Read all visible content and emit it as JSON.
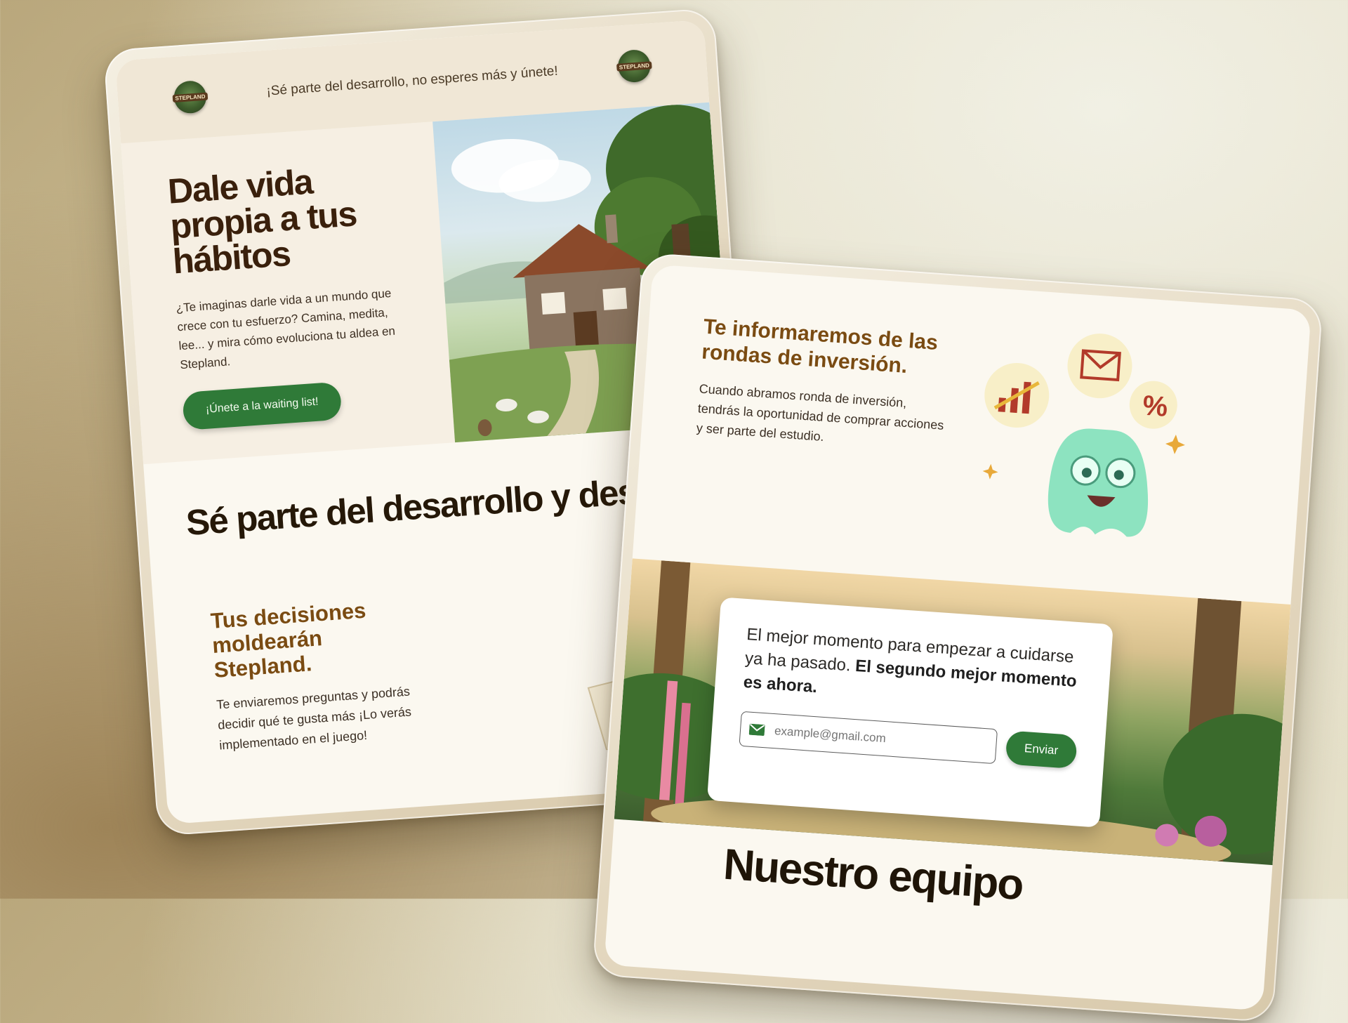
{
  "colors": {
    "accent_green": "#2f7a38",
    "heading_brown": "#7a4b12",
    "dark_title": "#251808",
    "paper": "#fbf8f0"
  },
  "tablet_a": {
    "topbar": {
      "logo_left": "STEPLAND",
      "logo_right": "STEPLAND",
      "message": "¡Sé parte del desarrollo, no esperes más y únete!"
    },
    "hero": {
      "title": "Dale vida propia a tus hábitos",
      "body": "¿Te imaginas darle vida a un mundo que crece con tu esfuerzo? Camina, medita, lee... y mira cómo evoluciona tu aldea en Stepland.",
      "cta_label": "¡Únete a la waiting list!",
      "image_icon": "cottage-illustration"
    },
    "section": {
      "title": "Sé parte del desarrollo y desbloquea contenido limita"
    },
    "feature": {
      "title": "Tus decisiones moldearán Stepland.",
      "body": "Te enviaremos preguntas y podrás decidir qué te gusta más ¡Lo verás implementado en el juego!",
      "art_icon": "mascot-notebook-illustration"
    }
  },
  "tablet_b": {
    "investment": {
      "title": "Te informaremos de las rondas de inversión.",
      "body": "Cuando abramos ronda de inversión, tendrás la oportunidad de comprar acciones y ser parte del estudio.",
      "art_icon": "ghost-mascot-illustration"
    },
    "cta": {
      "text_plain": "El mejor momento para empezar a cuidarse ya ha pasado.",
      "text_bold": "El segundo mejor momento es ahora.",
      "email_placeholder": "example@gmail.com",
      "email_icon": "mail-icon",
      "send_label": "Enviar",
      "background_icon": "forest-illustration"
    },
    "team_title": "Nuestro equipo"
  }
}
